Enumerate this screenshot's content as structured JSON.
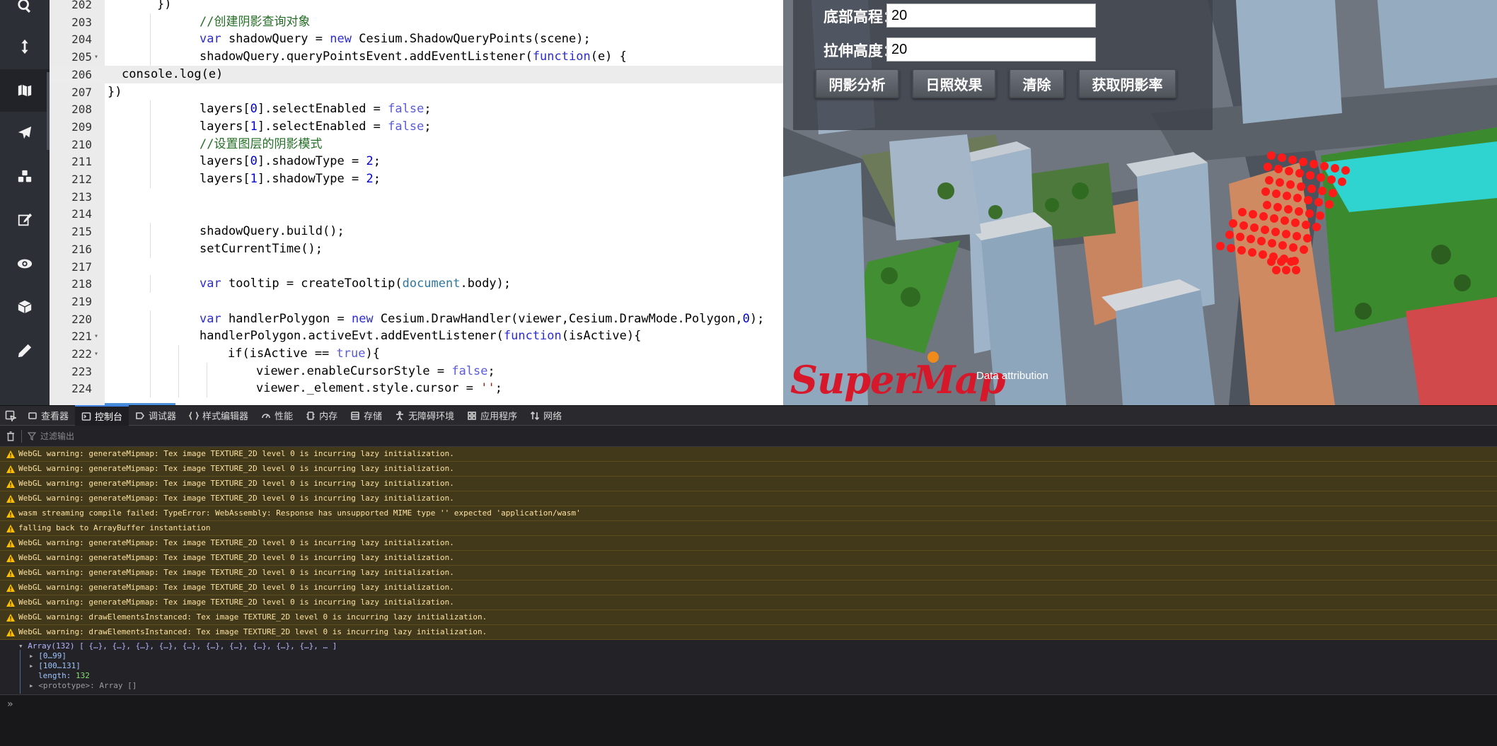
{
  "rail": {
    "items": [
      {
        "icon": "search-icon"
      },
      {
        "icon": "vertical-arrows-icon"
      },
      {
        "icon": "map-icon"
      },
      {
        "icon": "paper-plane-icon"
      },
      {
        "icon": "cubes-icon"
      },
      {
        "icon": "edit-icon"
      },
      {
        "icon": "eye-icon"
      },
      {
        "icon": "box-icon"
      },
      {
        "icon": "pencil-icon"
      }
    ]
  },
  "editor": {
    "lines": [
      {
        "n": "202",
        "text": "})"
      },
      {
        "n": "203",
        "text": "//创建阴影查询对象"
      },
      {
        "n": "204",
        "text": "var shadowQuery = new Cesium.ShadowQueryPoints(scene);"
      },
      {
        "n": "205",
        "text": "shadowQuery.queryPointsEvent.addEventListener(function(e) {"
      },
      {
        "n": "206",
        "text": "console.log(e)"
      },
      {
        "n": "207",
        "text": "})"
      },
      {
        "n": "208",
        "text": "layers[0].selectEnabled = false;"
      },
      {
        "n": "209",
        "text": "layers[1].selectEnabled = false;"
      },
      {
        "n": "210",
        "text": "//设置图层的阴影模式"
      },
      {
        "n": "211",
        "text": "layers[0].shadowType = 2;"
      },
      {
        "n": "212",
        "text": "layers[1].shadowType = 2;"
      },
      {
        "n": "213",
        "text": ""
      },
      {
        "n": "214",
        "text": ""
      },
      {
        "n": "215",
        "text": "shadowQuery.build();"
      },
      {
        "n": "216",
        "text": "setCurrentTime();"
      },
      {
        "n": "217",
        "text": ""
      },
      {
        "n": "218",
        "text": "var tooltip = createTooltip(document.body);"
      },
      {
        "n": "219",
        "text": ""
      },
      {
        "n": "220",
        "text": "var handlerPolygon = new Cesium.DrawHandler(viewer,Cesium.DrawMode.Polygon,0);"
      },
      {
        "n": "221",
        "text": "handlerPolygon.activeEvt.addEventListener(function(isActive){"
      },
      {
        "n": "222",
        "text": "if(isActive == true){"
      },
      {
        "n": "223",
        "text": "viewer.enableCursorStyle = false;"
      },
      {
        "n": "224",
        "text": "viewer._element.style.cursor = '';"
      }
    ]
  },
  "panel": {
    "bottom_label": "底部高程：",
    "bottom_value": "20",
    "extrude_label": "拉伸高度：",
    "extrude_value": "20",
    "buttons": [
      "阴影分析",
      "日照效果",
      "清除",
      "获取阴影率"
    ]
  },
  "scene": {
    "logo": "SuperMap",
    "attribution": "Data attribution"
  },
  "devtools": {
    "tabs": [
      {
        "label": "查看器",
        "icon": "inspector-icon"
      },
      {
        "label": "控制台",
        "icon": "console-icon",
        "active": true
      },
      {
        "label": "调试器",
        "icon": "debugger-icon"
      },
      {
        "label": "样式编辑器",
        "icon": "style-editor-icon"
      },
      {
        "label": "性能",
        "icon": "performance-icon"
      },
      {
        "label": "内存",
        "icon": "memory-icon"
      },
      {
        "label": "存储",
        "icon": "storage-icon"
      },
      {
        "label": "无障碍环境",
        "icon": "accessibility-icon"
      },
      {
        "label": "应用程序",
        "icon": "application-icon"
      },
      {
        "label": "网络",
        "icon": "network-icon"
      }
    ],
    "filter_placeholder": "过滤输出",
    "messages": [
      "WebGL warning: generateMipmap: Tex image TEXTURE_2D level 0 is incurring lazy initialization.",
      "WebGL warning: generateMipmap: Tex image TEXTURE_2D level 0 is incurring lazy initialization.",
      "WebGL warning: generateMipmap: Tex image TEXTURE_2D level 0 is incurring lazy initialization.",
      "WebGL warning: generateMipmap: Tex image TEXTURE_2D level 0 is incurring lazy initialization.",
      "wasm streaming compile failed: TypeError: WebAssembly: Response has unsupported MIME type '' expected 'application/wasm'",
      "falling back to ArrayBuffer instantiation",
      "WebGL warning: generateMipmap: Tex image TEXTURE_2D level 0 is incurring lazy initialization.",
      "WebGL warning: generateMipmap: Tex image TEXTURE_2D level 0 is incurring lazy initialization.",
      "WebGL warning: generateMipmap: Tex image TEXTURE_2D level 0 is incurring lazy initialization.",
      "WebGL warning: generateMipmap: Tex image TEXTURE_2D level 0 is incurring lazy initialization.",
      "WebGL warning: generateMipmap: Tex image TEXTURE_2D level 0 is incurring lazy initialization.",
      "WebGL warning: drawElementsInstanced: Tex image TEXTURE_2D level 0 is incurring lazy initialization.",
      "WebGL warning: drawElementsInstanced: Tex image TEXTURE_2D level 0 is incurring lazy initialization."
    ],
    "object": {
      "header": "Array(132) [ {…}, {…}, {…}, {…}, {…}, {…}, {…}, {…}, {…}, {…}, … ]",
      "range1": "[0…99]",
      "range2": "[100…131]",
      "length_key": "length:",
      "length_val": "132",
      "proto": "<prototype>: Array []"
    },
    "prompt": "»"
  },
  "colors": {
    "warning_bg": "#42381a",
    "warning_text": "#fce2a1",
    "active_tab_accent": "#3c7fe1",
    "shadow_points": "#ff1a1a"
  }
}
